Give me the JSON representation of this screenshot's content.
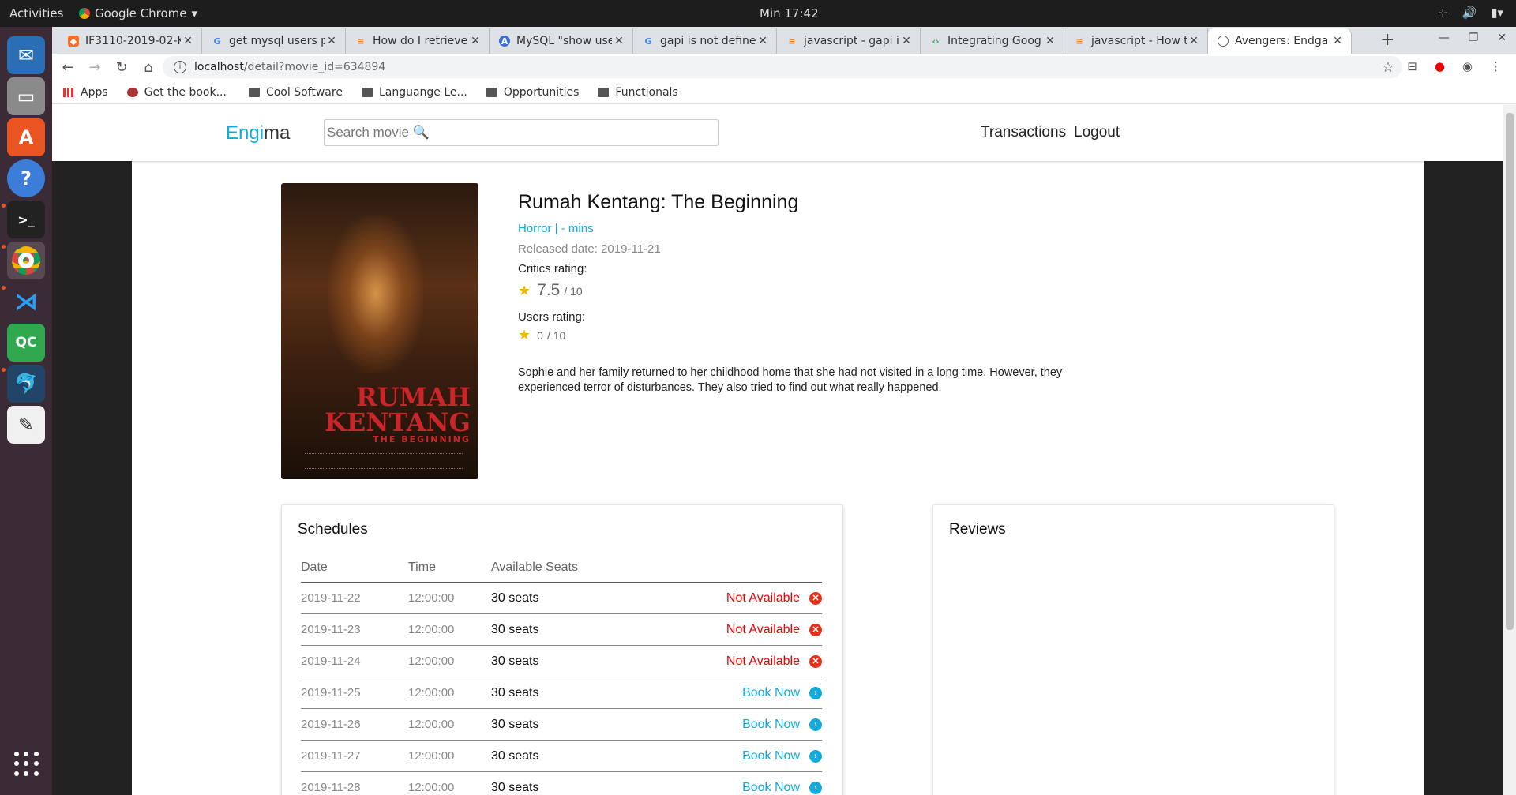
{
  "os": {
    "activities": "Activities",
    "app_name": "Google Chrome",
    "clock": "Min 17:42"
  },
  "browser": {
    "tabs": [
      {
        "title": "IF3110-2019-02-K0"
      },
      {
        "title": "get mysql users p"
      },
      {
        "title": "How do I retrieve"
      },
      {
        "title": "MySQL \"show use"
      },
      {
        "title": "gapi is not define"
      },
      {
        "title": "javascript - gapi is"
      },
      {
        "title": "Integrating Goog"
      },
      {
        "title": "javascript - How t"
      },
      {
        "title": "Avengers: Endga"
      }
    ],
    "url_host": "localhost",
    "url_path": "/detail?movie_id=634894",
    "bookmarks": [
      {
        "label": "Apps"
      },
      {
        "label": "Get the book..."
      },
      {
        "label": "Cool Software"
      },
      {
        "label": "Languange Le..."
      },
      {
        "label": "Opportunities"
      },
      {
        "label": "Functionals"
      }
    ]
  },
  "site": {
    "logo_part1": "Engi",
    "logo_part2": "ma",
    "search_placeholder": "Search movie 🔍",
    "nav": {
      "transactions": "Transactions",
      "logout": "Logout"
    }
  },
  "movie": {
    "title": "Rumah Kentang: The Beginning",
    "genre_line": "Horror | - mins",
    "released": "Released date: 2019-11-21",
    "critics_label": "Critics rating:",
    "critics_score": "7.5",
    "critics_max": "/ 10",
    "users_label": "Users rating:",
    "users_score": "0",
    "users_max": "/ 10",
    "synopsis": "Sophie and her family returned to her childhood home that she had not visited in a long time. However, they experienced terror of disturbances. They also tried to find out what really happened.",
    "poster_title_line1": "RUMAH",
    "poster_title_line2": "KENTANG",
    "poster_subtitle": "THE BEGINNING"
  },
  "schedules": {
    "heading": "Schedules",
    "columns": {
      "date": "Date",
      "time": "Time",
      "seats": "Available Seats"
    },
    "rows": [
      {
        "date": "2019-11-22",
        "time": "12:00:00",
        "seats": "30 seats",
        "status": "Not Available",
        "available": false
      },
      {
        "date": "2019-11-23",
        "time": "12:00:00",
        "seats": "30 seats",
        "status": "Not Available",
        "available": false
      },
      {
        "date": "2019-11-24",
        "time": "12:00:00",
        "seats": "30 seats",
        "status": "Not Available",
        "available": false
      },
      {
        "date": "2019-11-25",
        "time": "12:00:00",
        "seats": "30 seats",
        "status": "Book Now",
        "available": true
      },
      {
        "date": "2019-11-26",
        "time": "12:00:00",
        "seats": "30 seats",
        "status": "Book Now",
        "available": true
      },
      {
        "date": "2019-11-27",
        "time": "12:00:00",
        "seats": "30 seats",
        "status": "Book Now",
        "available": true
      },
      {
        "date": "2019-11-28",
        "time": "12:00:00",
        "seats": "30 seats",
        "status": "Book Now",
        "available": true
      }
    ]
  },
  "reviews": {
    "heading": "Reviews"
  },
  "colors": {
    "accent": "#12abdb",
    "unavailable": "#e00000",
    "star": "#f5b800"
  }
}
